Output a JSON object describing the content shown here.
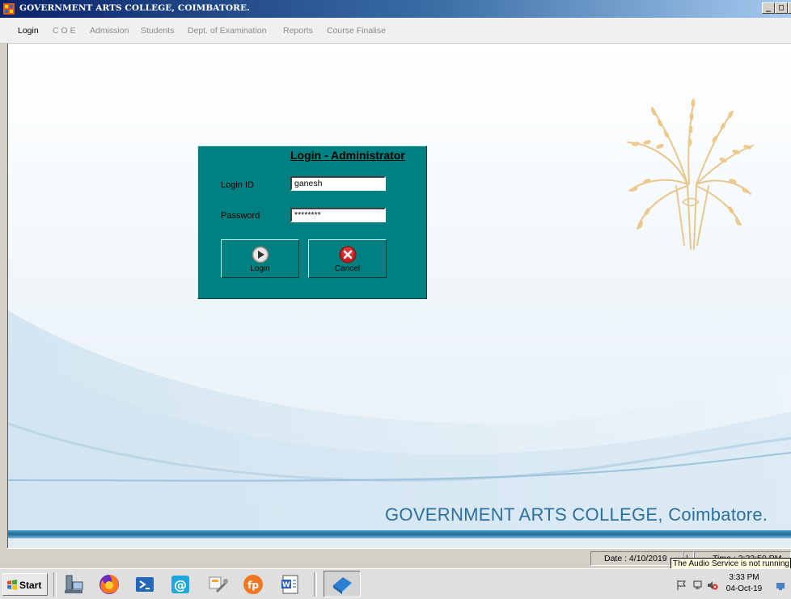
{
  "window": {
    "title": "GOVERNMENT ARTS COLLEGE, COIMBATORE.",
    "controls": [
      "_",
      "□",
      "×"
    ]
  },
  "menu": {
    "items": [
      {
        "label": "Login",
        "enabled": true
      },
      {
        "label": "C O E",
        "enabled": false
      },
      {
        "label": "Admission",
        "enabled": false
      },
      {
        "label": "Students",
        "enabled": false
      },
      {
        "label": "Dept. of Examination",
        "enabled": false
      },
      {
        "label": "Reports",
        "enabled": false
      },
      {
        "label": "Course Finalise",
        "enabled": false
      }
    ]
  },
  "login": {
    "title": "Login - Administrator",
    "login_id_label": "Login ID",
    "login_id_value": "ganesh",
    "password_label": "Password",
    "password_value": "********",
    "login_button": "Login",
    "cancel_button": "Cancel"
  },
  "background": {
    "college_name": "GOVERNMENT ARTS COLLEGE, Coimbatore."
  },
  "status": {
    "date": "Date  : 4/10/2019",
    "separator": "|",
    "time": "Time  : 3:33:50 PM"
  },
  "tooltip": "The Audio Service is not running",
  "taskbar": {
    "start_label": "Start",
    "clock_time": "3:33 PM",
    "clock_date": "04-Oct-19"
  },
  "colors": {
    "panel_teal": "#008080",
    "title_bar": "#0a246a",
    "footer_text": "#2c6f9f",
    "wave_blue": "#1e6fa0"
  }
}
